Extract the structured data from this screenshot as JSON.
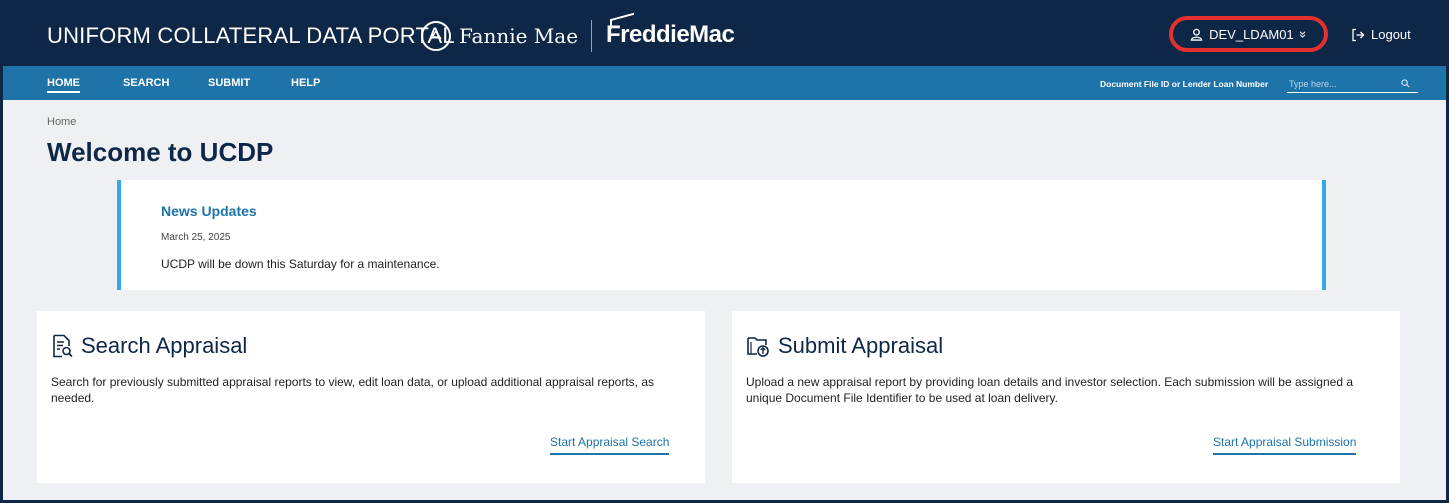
{
  "header": {
    "portal_title": "UNIFORM COLLATERAL DATA PORTAL",
    "fannie_logo_text": "Fannie Mae",
    "freddie_logo_text": "FreddieMac",
    "user_name": "DEV_LDAM01",
    "user_menu_chevron": "»",
    "logout_label": "Logout",
    "highlight_color": "#e53030"
  },
  "nav": {
    "items": [
      {
        "label": "HOME",
        "active": true
      },
      {
        "label": "SEARCH",
        "active": false
      },
      {
        "label": "SUBMIT",
        "active": false
      },
      {
        "label": "HELP",
        "active": false
      }
    ],
    "search_label": "Document File ID or Lender Loan Number",
    "search_placeholder": "Type here..."
  },
  "breadcrumb": "Home",
  "page_title": "Welcome to UCDP",
  "news": {
    "title": "News Updates",
    "date": "March 25, 2025",
    "message": "UCDP will be down this Saturday for a maintenance."
  },
  "cards": [
    {
      "title": "Search Appraisal",
      "icon": "search-document-icon",
      "description": "Search for previously submitted appraisal reports to view, edit loan data, or upload additional appraisal reports, as needed.",
      "link": "Start Appraisal Search"
    },
    {
      "title": "Submit Appraisal",
      "icon": "upload-folder-icon",
      "description": "Upload a new appraisal report by providing loan details and investor selection. Each submission will be assigned a unique Document File Identifier to be used at loan delivery.",
      "link": "Start Appraisal Submission"
    }
  ],
  "colors": {
    "header_bg": "#0f2747",
    "nav_bg": "#1e73a8",
    "news_accent": "#35a8e6",
    "link": "#1e73a8"
  }
}
